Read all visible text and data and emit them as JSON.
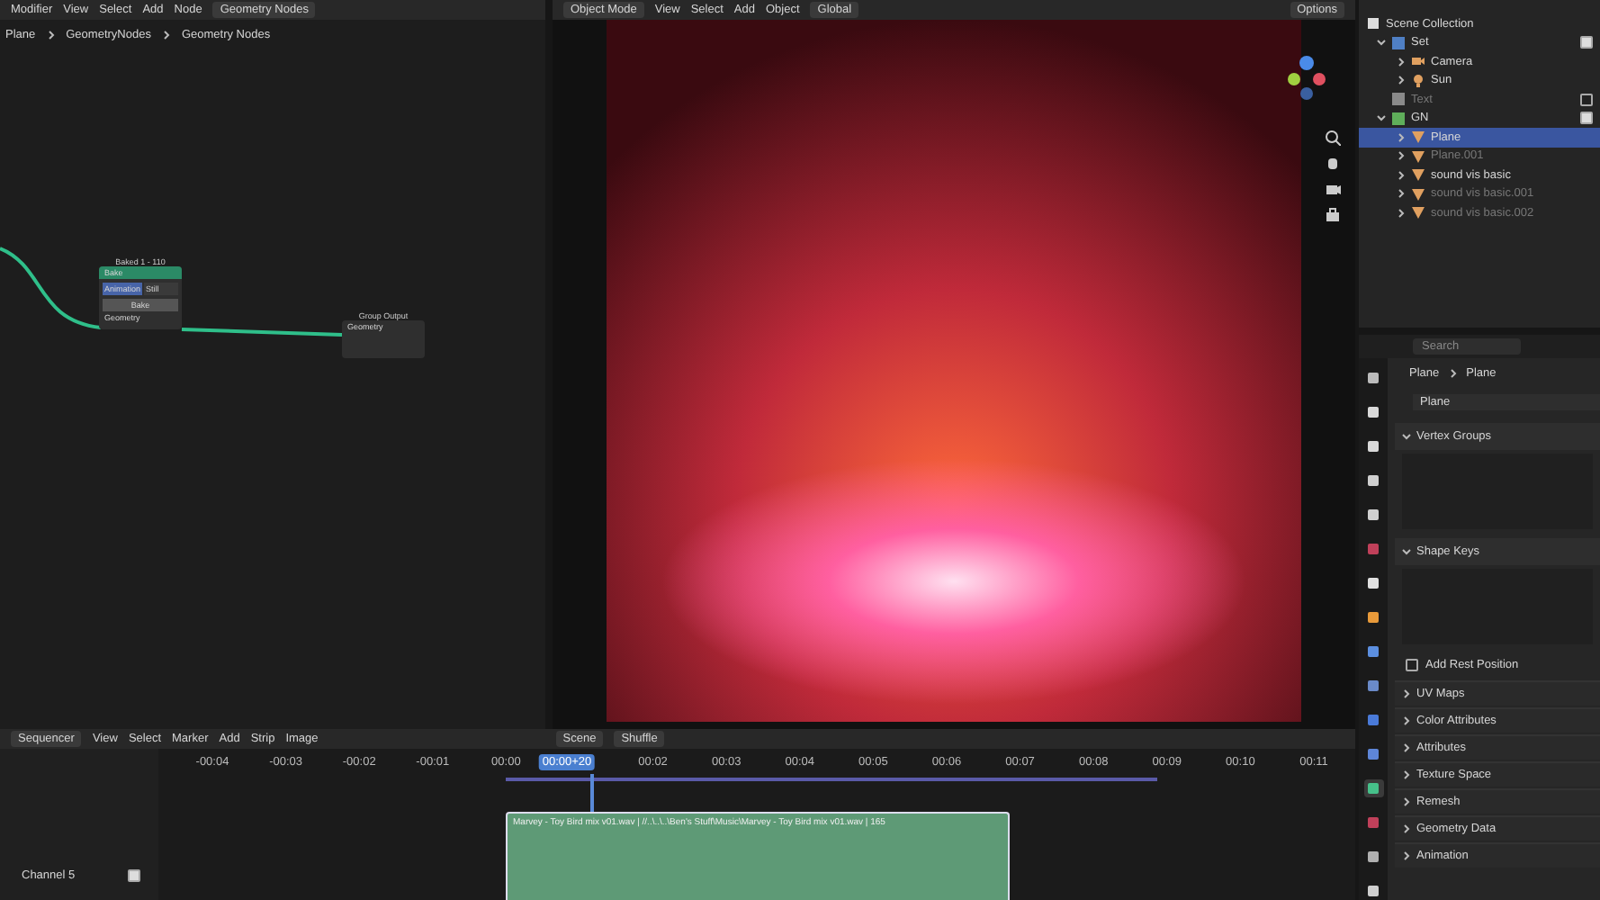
{
  "node_editor": {
    "menu": [
      "Modifier",
      "View",
      "Select",
      "Add",
      "Node"
    ],
    "tree_name": "Geometry Nodes",
    "breadcrumb": [
      "Plane",
      "GeometryNodes",
      "Geometry Nodes"
    ],
    "nodes": [
      {
        "kind": "bake",
        "title": "Baked 1 - 110",
        "header": "Bake",
        "mode": "Animation",
        "mode_alt": "Still",
        "button": "Bake",
        "socket": "Geometry"
      },
      {
        "kind": "output",
        "title": "Group Output",
        "socket": "Geometry"
      }
    ]
  },
  "viewport": {
    "mode": "Object Mode",
    "menu": [
      "View",
      "Select",
      "Add",
      "Object"
    ],
    "orientation": "Global",
    "options": "Options"
  },
  "outliner": {
    "root": "Scene Collection",
    "children": [
      {
        "name": "Set",
        "color": "#4f7fc4",
        "checked": true,
        "disabled": false,
        "children": [
          {
            "kind": "camera",
            "name": "Camera",
            "selected": false,
            "disabled": false
          },
          {
            "kind": "light",
            "name": "Sun",
            "selected": false,
            "disabled": false
          }
        ]
      },
      {
        "name": "Text",
        "color": "#8a8a8a",
        "checked": false,
        "disabled": true
      },
      {
        "name": "GN",
        "color": "#5fae5a",
        "checked": true,
        "disabled": false,
        "children": [
          {
            "kind": "mesh",
            "name": "Plane",
            "selected": true,
            "disabled": false
          },
          {
            "kind": "mesh",
            "name": "Plane.001",
            "selected": false,
            "disabled": true
          },
          {
            "kind": "mesh",
            "name": "sound vis basic",
            "selected": false,
            "disabled": false
          },
          {
            "kind": "mesh",
            "name": "sound vis basic.001",
            "selected": false,
            "disabled": true
          },
          {
            "kind": "mesh",
            "name": "sound vis basic.002",
            "selected": false,
            "disabled": true
          }
        ]
      }
    ]
  },
  "properties": {
    "search": {
      "placeholder": "Search"
    },
    "breadcrumb": [
      "Plane",
      "Plane"
    ],
    "data_name": "Plane",
    "tabs": [
      {
        "kind": "tool",
        "selected": false
      },
      {
        "kind": "render",
        "selected": false
      },
      {
        "kind": "output",
        "selected": false
      },
      {
        "kind": "view",
        "selected": false
      },
      {
        "kind": "scene",
        "selected": false
      },
      {
        "kind": "world",
        "selected": false
      },
      {
        "kind": "collection",
        "selected": false
      },
      {
        "kind": "object",
        "selected": false
      },
      {
        "kind": "modifier",
        "selected": false
      },
      {
        "kind": "particles",
        "selected": false
      },
      {
        "kind": "physics",
        "selected": false
      },
      {
        "kind": "constraints",
        "selected": false
      },
      {
        "kind": "data",
        "selected": true
      },
      {
        "kind": "material",
        "selected": false
      },
      {
        "kind": "texture",
        "selected": false
      },
      {
        "kind": "view",
        "selected": false
      }
    ],
    "panels": [
      {
        "kind": "list",
        "label": "Vertex Groups",
        "expanded": true
      },
      {
        "kind": "list",
        "label": "Shape Keys",
        "expanded": true
      },
      {
        "kind": "checkbox",
        "label": "Add Rest Position",
        "checked": false
      },
      {
        "kind": "panel",
        "label": "UV Maps",
        "expanded": false
      },
      {
        "kind": "panel",
        "label": "Color Attributes",
        "expanded": false
      },
      {
        "kind": "panel",
        "label": "Attributes",
        "expanded": false
      },
      {
        "kind": "panel",
        "label": "Texture Space",
        "expanded": false
      },
      {
        "kind": "panel",
        "label": "Remesh",
        "expanded": false
      },
      {
        "kind": "panel",
        "label": "Geometry Data",
        "expanded": false
      },
      {
        "kind": "panel",
        "label": "Animation",
        "expanded": false
      }
    ]
  },
  "sequencer": {
    "editor": "Sequencer",
    "menu": [
      "View",
      "Select",
      "Marker",
      "Add",
      "Strip",
      "Image"
    ],
    "scene": "Scene",
    "overlap_mode": "Shuffle",
    "ticks": [
      {
        "label": "-00:04",
        "selected": false
      },
      {
        "label": "-00:03",
        "selected": false
      },
      {
        "label": "-00:02",
        "selected": false
      },
      {
        "label": "-00:01",
        "selected": false
      },
      {
        "label": "00:00",
        "selected": false
      },
      {
        "label": "00:00+20",
        "selected": true
      },
      {
        "label": "00:02",
        "selected": false
      },
      {
        "label": "00:03",
        "selected": false
      },
      {
        "label": "00:04",
        "selected": false
      },
      {
        "label": "00:05",
        "selected": false
      },
      {
        "label": "00:06",
        "selected": false
      },
      {
        "label": "00:07",
        "selected": false
      },
      {
        "label": "00:08",
        "selected": false
      },
      {
        "label": "00:09",
        "selected": false
      },
      {
        "label": "00:10",
        "selected": false
      },
      {
        "label": "00:11",
        "selected": false
      }
    ],
    "channel": {
      "name": "Channel 5",
      "checked": true
    },
    "strip": {
      "label": "Marvey - Toy Bird mix v01.wav | //..\\..\\..\\Ben's Stuff\\Music\\Marvey - Toy Bird mix v01.wav | 165"
    }
  }
}
